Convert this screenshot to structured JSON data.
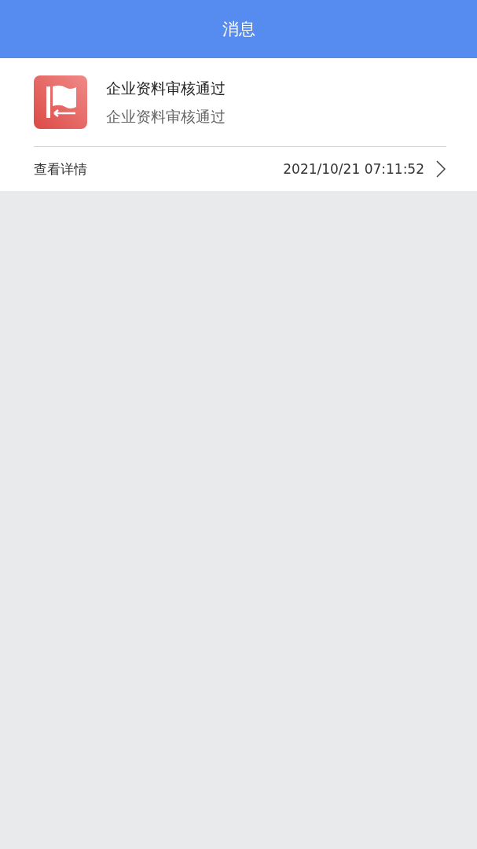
{
  "header": {
    "title": "消息"
  },
  "messages": [
    {
      "title": "企业资料审核通过",
      "body": "企业资料审核通过",
      "action": "查看详情",
      "time": "2021/10/21 07:11:52"
    }
  ]
}
